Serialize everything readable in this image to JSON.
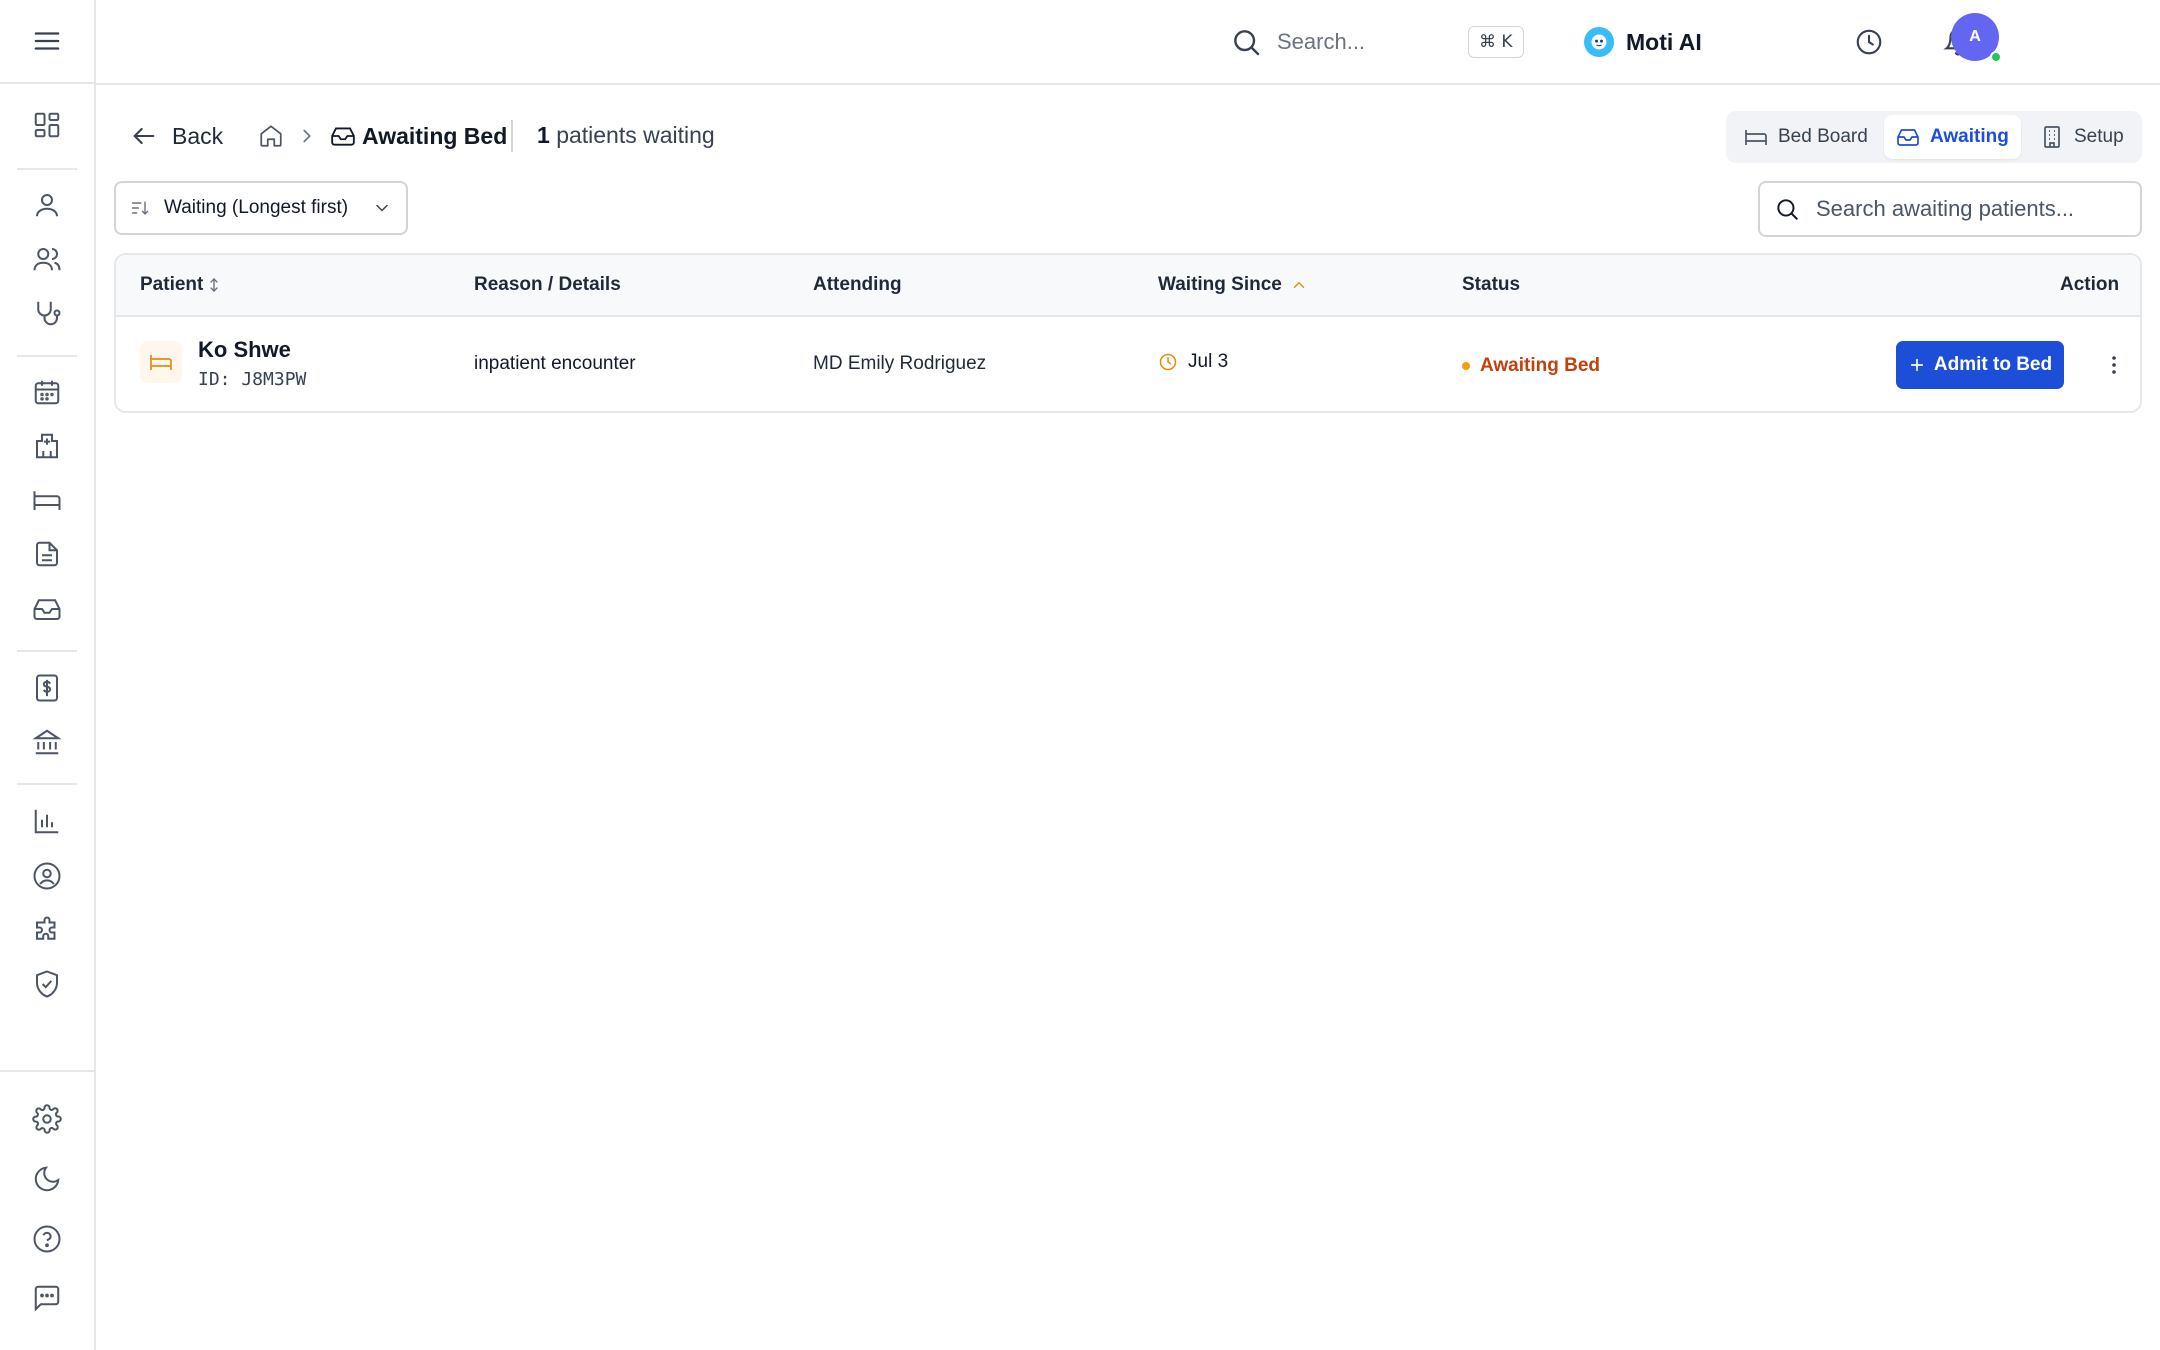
{
  "topbar": {
    "search_placeholder": "Search...",
    "shortcut": "⌘ K",
    "assistant_label": "Moti AI",
    "avatar_initial": "A"
  },
  "sidebar": {
    "icons": [
      "menu-icon",
      "dashboard-icon",
      "user-icon",
      "users-icon",
      "stethoscope-icon",
      "calendar-icon",
      "hospital-icon",
      "bed-icon",
      "document-icon",
      "inbox-icon",
      "billing-icon",
      "bank-icon",
      "chart-icon",
      "user-circle-icon",
      "puzzle-icon",
      "shield-check-icon",
      "settings-icon",
      "moon-icon",
      "help-icon",
      "chat-icon"
    ]
  },
  "header": {
    "back_label": "Back",
    "breadcrumb_current": "Awaiting Bed",
    "waiting_count": "1",
    "waiting_suffix": "patients waiting"
  },
  "view_tabs": {
    "bed_board": "Bed Board",
    "awaiting": "Awaiting",
    "setup": "Setup",
    "active": "Awaiting"
  },
  "filters": {
    "sort_value": "Waiting (Longest first)",
    "search_placeholder": "Search awaiting patients..."
  },
  "table": {
    "columns": {
      "patient": "Patient",
      "reason": "Reason / Details",
      "attending": "Attending",
      "waiting_since": "Waiting Since",
      "status": "Status",
      "action": "Action"
    },
    "rows": [
      {
        "name": "Ko Shwe",
        "id": "ID: J8M3PW",
        "reason": "inpatient encounter",
        "attending": "MD Emily Rodriguez",
        "waiting_since": "Jul 3",
        "status": "Awaiting Bed",
        "action": "Admit to Bed"
      }
    ]
  },
  "colors": {
    "accent": "#1d4ed8",
    "status": "#c2410c",
    "status_dot": "#f59e0b",
    "avatar": "#6366f1"
  }
}
